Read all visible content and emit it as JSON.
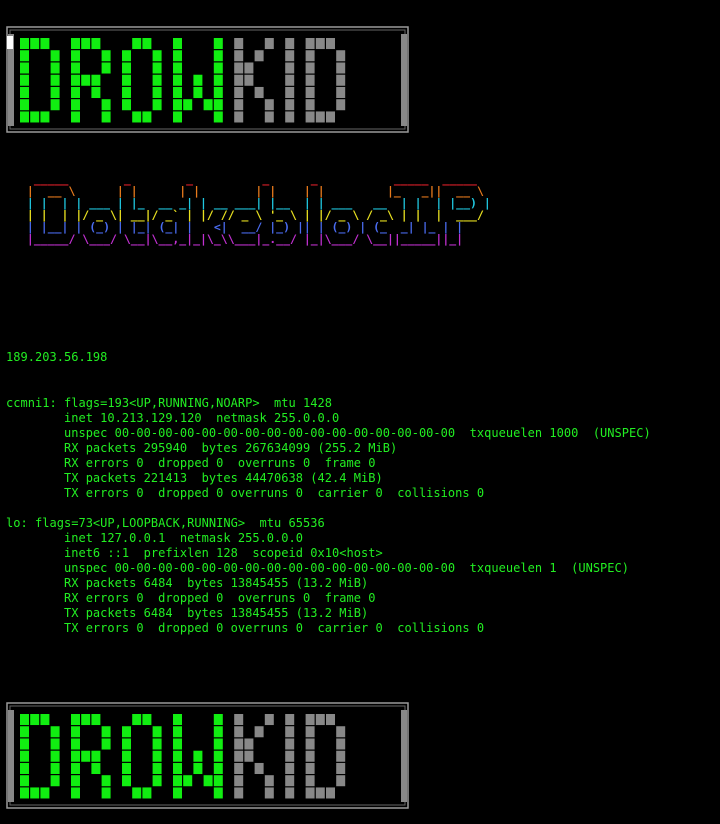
{
  "banner": {
    "word_green": "DROW",
    "word_gray": "KID",
    "color_green": "#11ee11",
    "color_gray": "#888888"
  },
  "tagline": {
    "art_lines": [
      "  _____        _        _          _      _           _____  _____",
      " |  __ \\      | |      | |        | |    | |         |_   _||  __ \\",
      " | |  | | ___ | |_  __ _| | __ ___| |__  | | ___   __  | |  | |__) |",
      " | |  | |/ _ \\| __|/ _` | |/ // _ \\ '_ \\ | |/ _ \\ / _\\ | |  |  ___/",
      " | |__| | (_) | |_| (_| |   <|  __/ |_) || | (_) | (_  _| |_ | |",
      " |_____/ \\___/ \\__|\\__,_|_|\\_\\\\___|_.__/ |_|\\___/ \\__||_____||_|"
    ],
    "colors": [
      "#e0202a",
      "#e87a1c",
      "#20c8e0",
      "#e8e020",
      "#4a6cf0",
      "#c030d0"
    ]
  },
  "ip_address": "189.203.56.198",
  "interfaces": [
    {
      "lines": [
        "ccmni1: flags=193<UP,RUNNING,NOARP>  mtu 1428",
        "        inet 10.213.129.120  netmask 255.0.0.0",
        "        unspec 00-00-00-00-00-00-00-00-00-00-00-00-00-00-00-00  txqueuelen 1000  (UNSPEC)",
        "        RX packets 295940  bytes 267634099 (255.2 MiB)",
        "        RX errors 0  dropped 0  overruns 0  frame 0",
        "        TX packets 221413  bytes 44470638 (42.4 MiB)",
        "        TX errors 0  dropped 0 overruns 0  carrier 0  collisions 0"
      ]
    },
    {
      "lines": [
        "lo: flags=73<UP,LOOPBACK,RUNNING>  mtu 65536",
        "        inet 127.0.0.1  netmask 255.0.0.0",
        "        inet6 ::1  prefixlen 128  scopeid 0x10<host>",
        "        unspec 00-00-00-00-00-00-00-00-00-00-00-00-00-00-00-00  txqueuelen 1  (UNSPEC)",
        "        RX packets 6484  bytes 13845455 (13.2 MiB)",
        "        RX errors 0  dropped 0  overruns 0  frame 0",
        "        TX packets 6484  bytes 13845455 (13.2 MiB)",
        "        TX errors 0  dropped 0 overruns 0  carrier 0  collisions 0"
      ]
    }
  ]
}
